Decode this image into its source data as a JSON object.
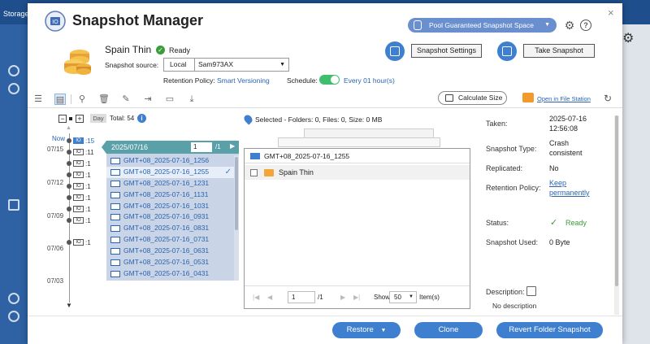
{
  "background": {
    "app_label": "Storage"
  },
  "header": {
    "title": "Snapshot Manager",
    "pool_button": "Pool Guaranteed Snapshot Space",
    "help_glyph": "?",
    "close_glyph": "×"
  },
  "volume": {
    "name": "Spain Thin",
    "status": "Ready",
    "source_label": "Snapshot source:",
    "source_location": "Local",
    "source_name": "Sam973AX",
    "retention_label": "Retention Policy:",
    "retention_value": "Smart Versioning",
    "schedule_label": "Schedule:",
    "schedule_value": "Every 01 hour(s)",
    "schedule_enabled": true
  },
  "actions": {
    "snapshot_settings": "Snapshot Settings",
    "take_snapshot": "Take Snapshot"
  },
  "toolbar": {
    "calculate_size": "Calculate Size",
    "open_file_station": "Open in File Station"
  },
  "timeline": {
    "minus": "−",
    "plus": "+",
    "mode": "Day",
    "total": "Total: 54",
    "info_glyph": "i",
    "now_label": "Now",
    "dates": [
      "07/15",
      "07/12",
      "07/09",
      "07/06",
      "07/03"
    ],
    "entries": [
      {
        "icon": "IO",
        "count": ":15",
        "current": true
      },
      {
        "icon": "IO",
        "count": ":11",
        "current": false
      },
      {
        "icon": "IO",
        "count": ":1",
        "current": false
      },
      {
        "icon": "IO",
        "count": ":1",
        "current": false
      },
      {
        "icon": "IO",
        "count": ":1",
        "current": false
      },
      {
        "icon": "IO",
        "count": ":1",
        "current": false
      },
      {
        "icon": "IO",
        "count": ":1",
        "current": false
      },
      {
        "icon": "IO",
        "count": ":1",
        "current": false
      },
      {
        "icon": "IO",
        "count": ":1",
        "current": false
      }
    ]
  },
  "snapshot_list": {
    "date": "2025/07/16",
    "page": "1",
    "page_total": "/1",
    "items": [
      {
        "name": "GMT+08_2025-07-16_1256",
        "selected": false
      },
      {
        "name": "GMT+08_2025-07-16_1255",
        "selected": true
      },
      {
        "name": "GMT+08_2025-07-16_1231",
        "selected": false
      },
      {
        "name": "GMT+08_2025-07-16_1131",
        "selected": false
      },
      {
        "name": "GMT+08_2025-07-16_1031",
        "selected": false
      },
      {
        "name": "GMT+08_2025-07-16_0931",
        "selected": false
      },
      {
        "name": "GMT+08_2025-07-16_0831",
        "selected": false
      },
      {
        "name": "GMT+08_2025-07-16_0731",
        "selected": false
      },
      {
        "name": "GMT+08_2025-07-16_0631",
        "selected": false
      },
      {
        "name": "GMT+08_2025-07-16_0531",
        "selected": false
      },
      {
        "name": "GMT+08_2025-07-16_0431",
        "selected": false
      }
    ]
  },
  "file_browser": {
    "selection_info": "Selected - Folders: 0, Files: 0, Size: 0 MB",
    "snapshot_name": "GMT+08_2025-07-16_1255",
    "rows": [
      {
        "name": "Spain Thin"
      }
    ],
    "page": "1",
    "page_of": "/1",
    "show_label": "Show",
    "show_value": "50",
    "items_label": "Item(s)"
  },
  "properties": {
    "taken_label": "Taken:",
    "taken_date": "2025-07-16",
    "taken_time": "12:56:08",
    "type_label": "Snapshot Type:",
    "type_line1": "Crash",
    "type_line2": "consistent",
    "replicated_label": "Replicated:",
    "replicated_value": "No",
    "retention_label": "Retention Policy:",
    "retention_line1": "Keep",
    "retention_line2": "permanently",
    "status_label": "Status:",
    "status_value": "Ready",
    "used_label": "Snapshot Used:",
    "used_value": "0 Byte",
    "description_label": "Description:",
    "description_value": "No description"
  },
  "footer": {
    "restore": "Restore",
    "clone": "Clone",
    "revert": "Revert Folder Snapshot"
  },
  "colors": {
    "accent": "#3f7fd0",
    "link": "#2b64b0",
    "success": "#3a9d3a",
    "timeline_header": "#5aa0a8",
    "pool_button": "#6a8fcf"
  }
}
